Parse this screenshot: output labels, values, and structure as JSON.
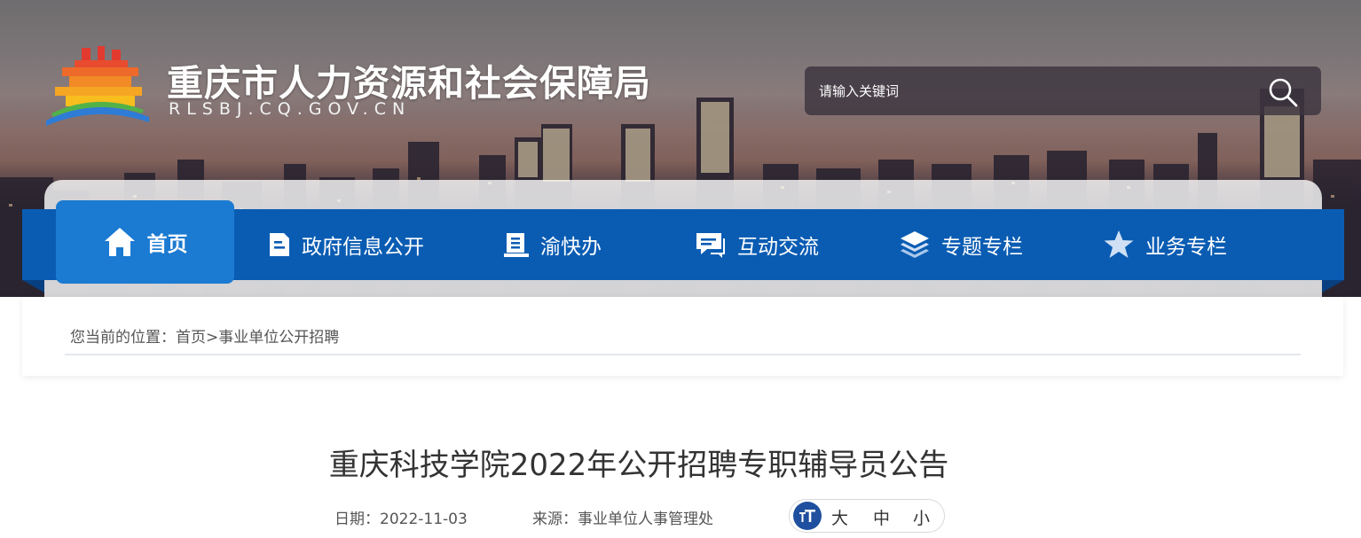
{
  "header": {
    "site_title": "重庆市人力资源和社会保障局",
    "site_domain": "RLSBJ.CQ.GOV.CN"
  },
  "search": {
    "placeholder": "请输入关键词",
    "icon": "search-icon"
  },
  "nav": {
    "items": [
      {
        "label": "首页",
        "icon": "home-icon",
        "active": true
      },
      {
        "label": "政府信息公开",
        "icon": "document-icon"
      },
      {
        "label": "渝快办",
        "icon": "form-icon"
      },
      {
        "label": "互动交流",
        "icon": "chat-icon"
      },
      {
        "label": "专题专栏",
        "icon": "layers-icon"
      },
      {
        "label": "业务专栏",
        "icon": "star-icon"
      }
    ]
  },
  "breadcrumb": {
    "prefix": "您当前的位置：",
    "home": "首页",
    "separator": ">",
    "current": "事业单位公开招聘"
  },
  "article": {
    "title": "重庆科技学院2022年公开招聘专职辅导员公告",
    "date_label": "日期：",
    "date": "2022-11-03",
    "source_label": "来源：",
    "source": "事业单位人事管理处",
    "font_size_options": [
      "大",
      "中",
      "小"
    ]
  },
  "colors": {
    "nav_bar": "#0a5cb3",
    "nav_active": "#1b7ad1",
    "font_icon": "#1f4f9e"
  }
}
